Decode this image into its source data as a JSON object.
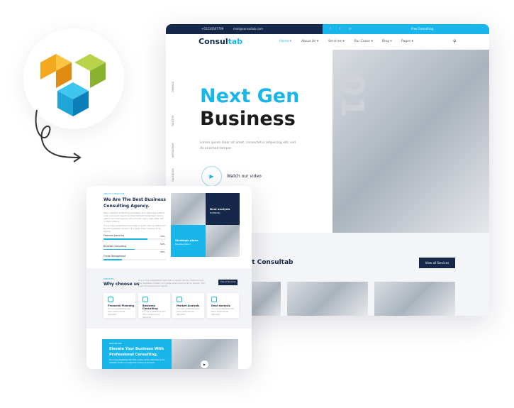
{
  "colors": {
    "accent": "#19b6ec",
    "navy": "#15284a"
  },
  "topbar": {
    "phone": "+01234567789",
    "email": "mail@consultab.com",
    "social": [
      "f",
      "t",
      "in"
    ],
    "cta": "Free Consulting"
  },
  "nav": {
    "brand_a": "Consul",
    "brand_b": "tab",
    "items": [
      "Home ▾",
      "About Us ▾",
      "Services ▾",
      "Our Cases ▾",
      "Blog ▾",
      "Pages ▾"
    ],
    "search_icon": "search-icon"
  },
  "hero": {
    "line1": "Next Gen",
    "line2": "Business",
    "text": "Lorem ipsum dolor sit amet, consectetur adipiscing elit, sed do eiusmod tempor.",
    "video": "Watch our video",
    "number": "01",
    "social": [
      "DRIBBLE",
      "TWITTER",
      "INSTAGRAM",
      "FACEBOOK"
    ]
  },
  "trust": {
    "heading": "rust Consultab",
    "button": "View all Services"
  },
  "about": {
    "eyebrow": "ABOUT CONSULTAB",
    "title1": "We Are The Best Business",
    "title2": "Consulting Agency.",
    "p1": "Many desktop publishing packages and web page editors now use Lorem Ipsum as their default model text, and a search for lorem ipsum will uncover many web sites still in their infancy.",
    "p2": "It is a long established fact that a reader will be distracted by the readable content of a page when looking at its layout.",
    "skills": [
      {
        "label": "Financial planning",
        "percent": 70
      },
      {
        "label": "Business Consulting",
        "percent": 50
      },
      {
        "label": "Funds Management",
        "percent": 30
      }
    ],
    "tile1": {
      "title": "Deal analysis",
      "sub": "Profitability"
    },
    "tile2": {
      "title": "Strategic plans",
      "sub": "Business Advisor"
    }
  },
  "why": {
    "eyebrow": "SERVICES",
    "title": "Why choose us",
    "text": "It is a long established fact that a reader will be distracted by the readable content of a page when looking at its layout. The point of using Lorem Ipsum.",
    "button": "View all Services",
    "services": [
      {
        "title": "Financial Planning",
        "text": "It is a long established fact that a reader will be distracted."
      },
      {
        "title": "Business Consulting",
        "text": "It is a long established fact that a reader will be distracted."
      },
      {
        "title": "Market Analysis",
        "text": "It is a long established fact that a reader will be distracted."
      },
      {
        "title": "Deal analysis",
        "text": "It is a long established fact that a reader will be distracted."
      }
    ]
  },
  "elevate": {
    "eyebrow": "WHO WE ARE",
    "title1": "Elevate Your Business With",
    "title2": "Professional Consulting.",
    "text": "It is a long established fact that a reader will be distracted by the readable content of a page when looking at its layout."
  }
}
